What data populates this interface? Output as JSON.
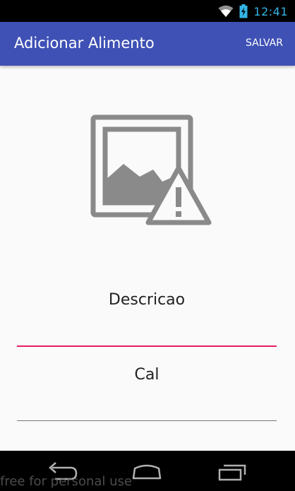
{
  "status_bar": {
    "time": "12:41",
    "icons": [
      "wifi-icon",
      "battery-charging-icon"
    ],
    "accent_color": "#33b5e5"
  },
  "app_bar": {
    "title": "Adicionar Alimento",
    "save_label": "SALVAR",
    "color": "#3f51b5"
  },
  "image": {
    "icon": "broken-image-icon"
  },
  "form": {
    "description_value": "Descricao",
    "calories_value": "Cal",
    "focused_underline_color": "#e91e63",
    "underline_color": "#757575"
  },
  "nav_bar": {
    "buttons": [
      "back-icon",
      "home-icon",
      "recent-apps-icon"
    ]
  },
  "watermark": "free for personal use"
}
